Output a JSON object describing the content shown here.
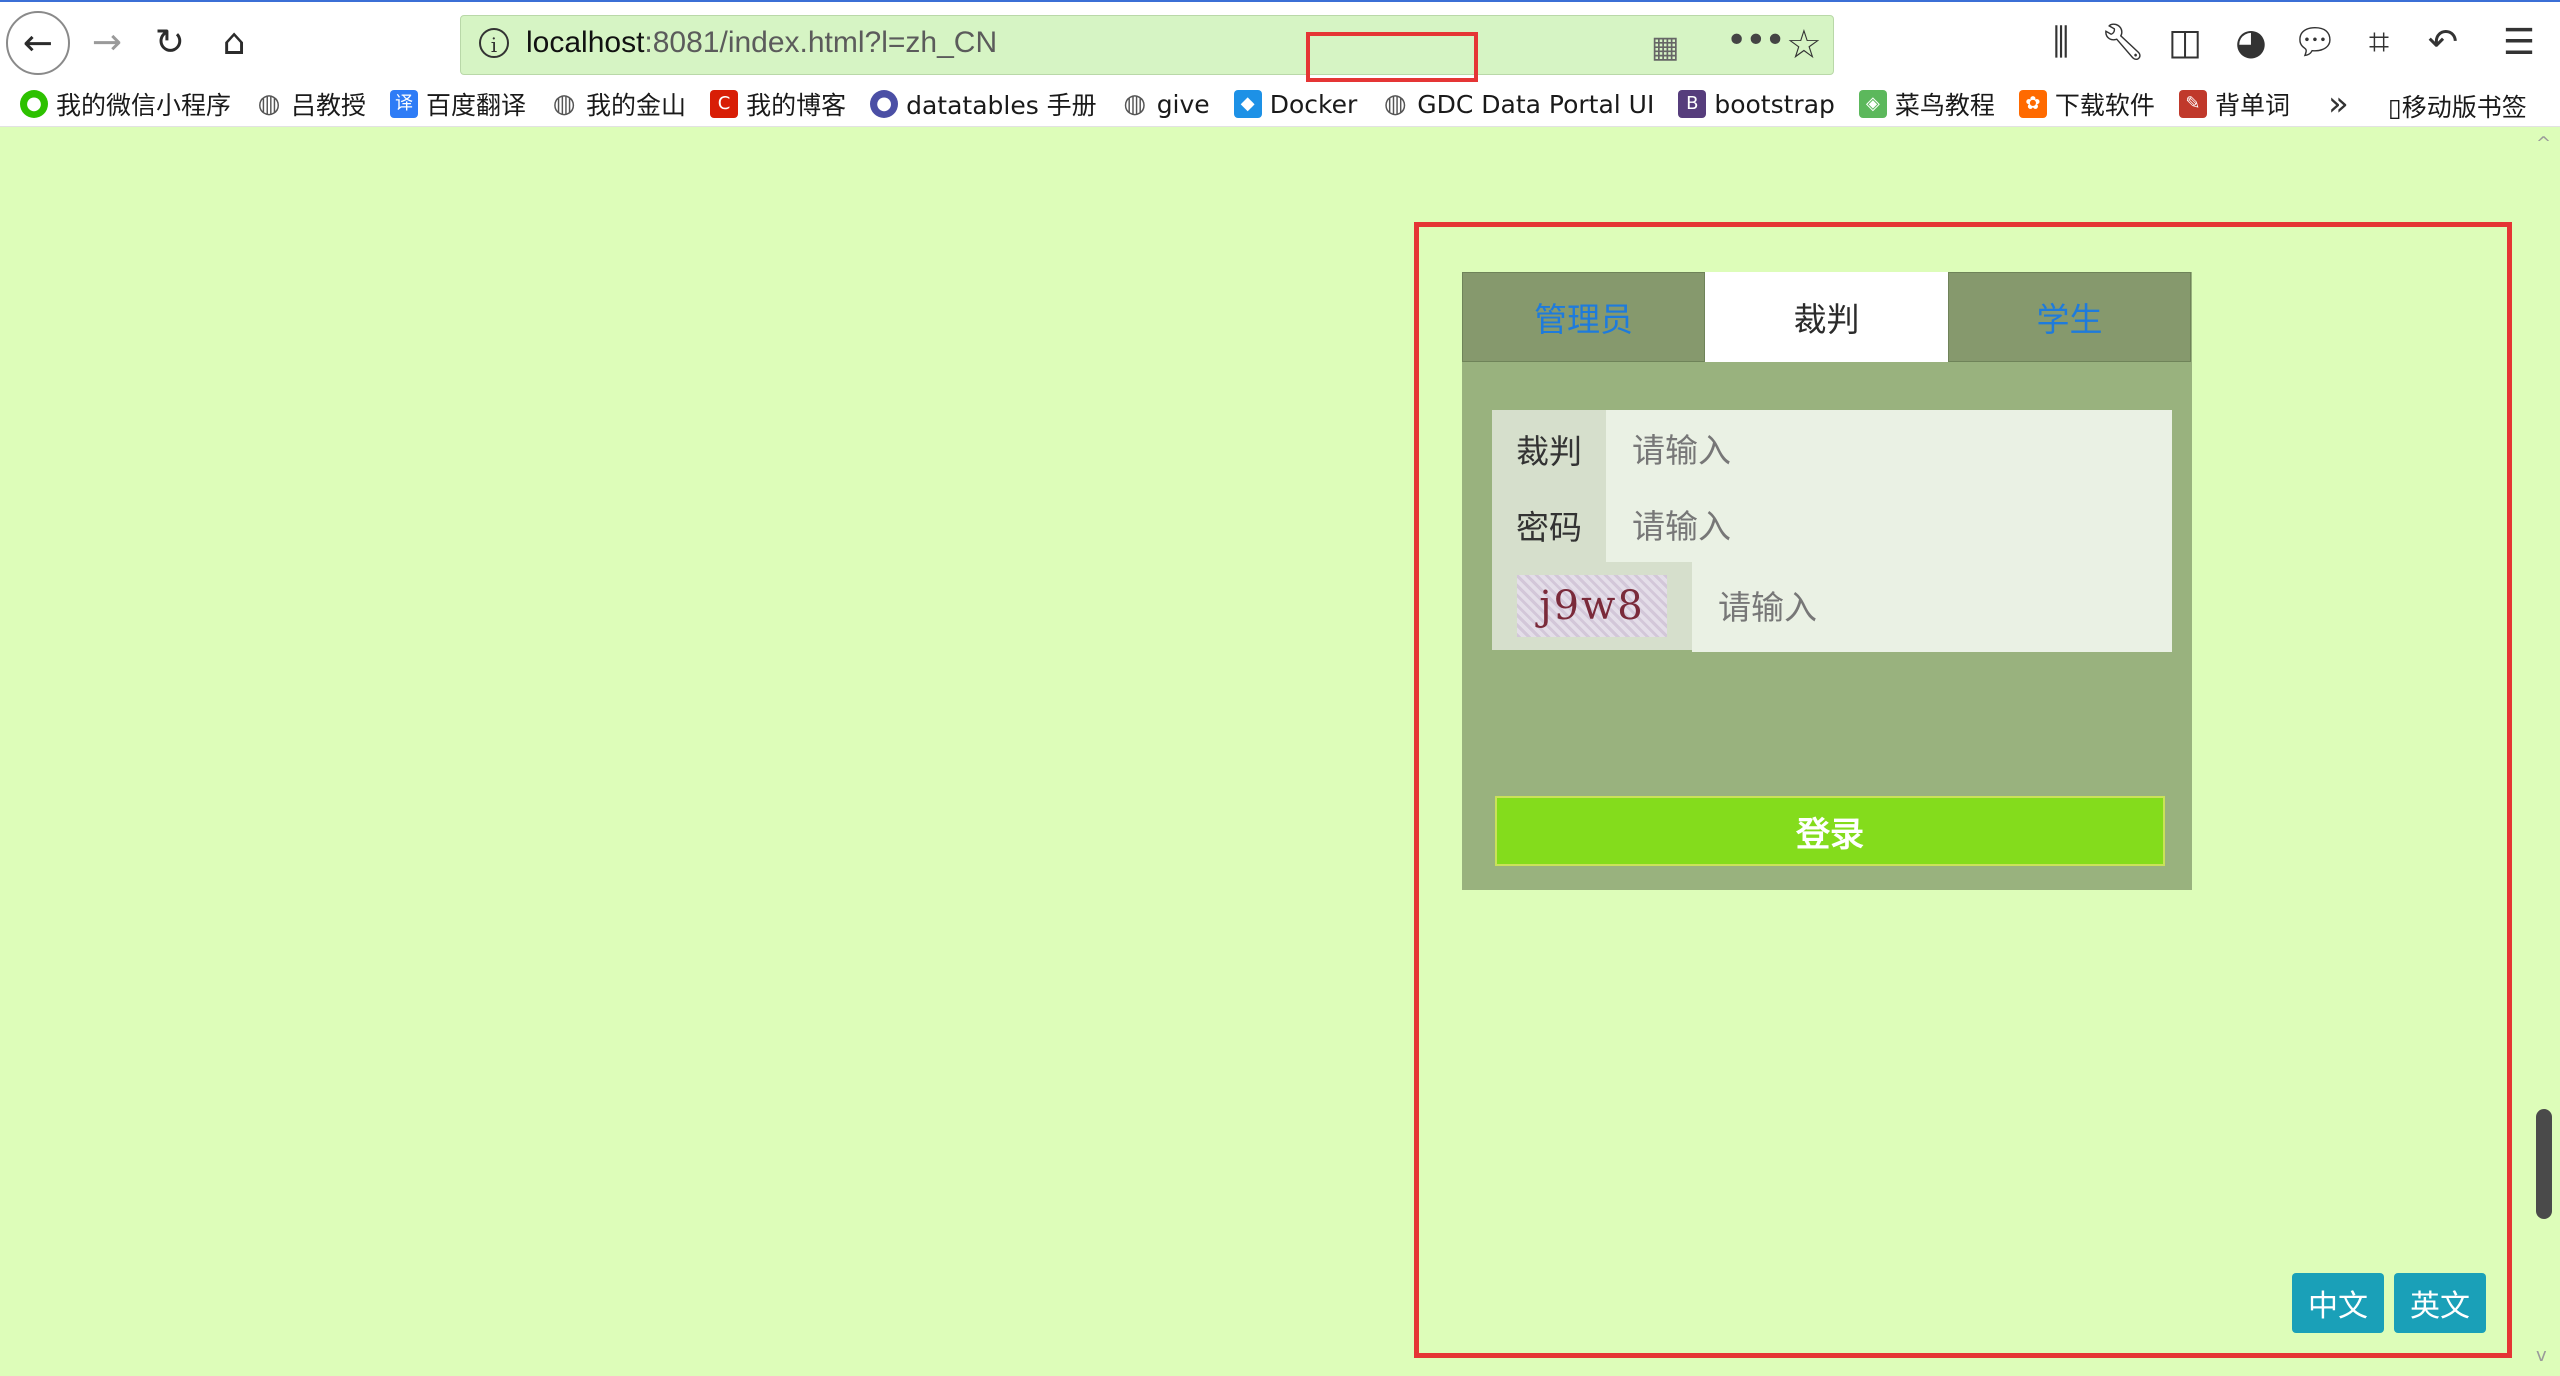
{
  "browser": {
    "url_host": "localhost",
    "url_rest": ":8081/index.html?l=zh_CN",
    "bookmarks": [
      {
        "label": "我的微信小程序",
        "icon": "wechat-icon",
        "color": "#2dc100"
      },
      {
        "label": "吕教授",
        "icon": "globe-icon",
        "color": "#555555"
      },
      {
        "label": "百度翻译",
        "icon": "translate-icon",
        "color": "#2e7cf6"
      },
      {
        "label": "我的金山",
        "icon": "globe-icon",
        "color": "#555555"
      },
      {
        "label": "我的博客",
        "icon": "blog-icon",
        "color": "#d81e06"
      },
      {
        "label": "datatables 手册",
        "icon": "datatables-icon",
        "color": "#4b4fa5"
      },
      {
        "label": "give",
        "icon": "globe-icon",
        "color": "#555555"
      },
      {
        "label": "Docker",
        "icon": "docker-icon",
        "color": "#1d91e6"
      },
      {
        "label": "GDC Data Portal UI",
        "icon": "globe-icon",
        "color": "#555555"
      },
      {
        "label": "bootstrap",
        "icon": "bootstrap-icon",
        "color": "#563d7c"
      },
      {
        "label": "菜鸟教程",
        "icon": "runoob-icon",
        "color": "#5cb85c"
      },
      {
        "label": "下载软件",
        "icon": "download-icon",
        "color": "#ff6a00"
      },
      {
        "label": "背单词",
        "icon": "vocab-icon",
        "color": "#c0392b"
      }
    ],
    "mobile_bookmarks": "移动版书签"
  },
  "login": {
    "tabs": [
      {
        "label": "管理员",
        "active": false
      },
      {
        "label": "裁判",
        "active": true
      },
      {
        "label": "学生",
        "active": false
      }
    ],
    "username_label": "裁判",
    "username_placeholder": "请输入",
    "password_label": "密码",
    "password_placeholder": "请输入",
    "captcha_text": "j9w8",
    "captcha_placeholder": "请输入",
    "submit_label": "登录"
  },
  "language": {
    "chinese_label": "中文",
    "english_label": "英文"
  },
  "colors": {
    "page_background": "#ddfdb9",
    "highlight_outline": "#e53535",
    "login_button": "#84dc1c",
    "lang_button": "#1aa0b8"
  }
}
